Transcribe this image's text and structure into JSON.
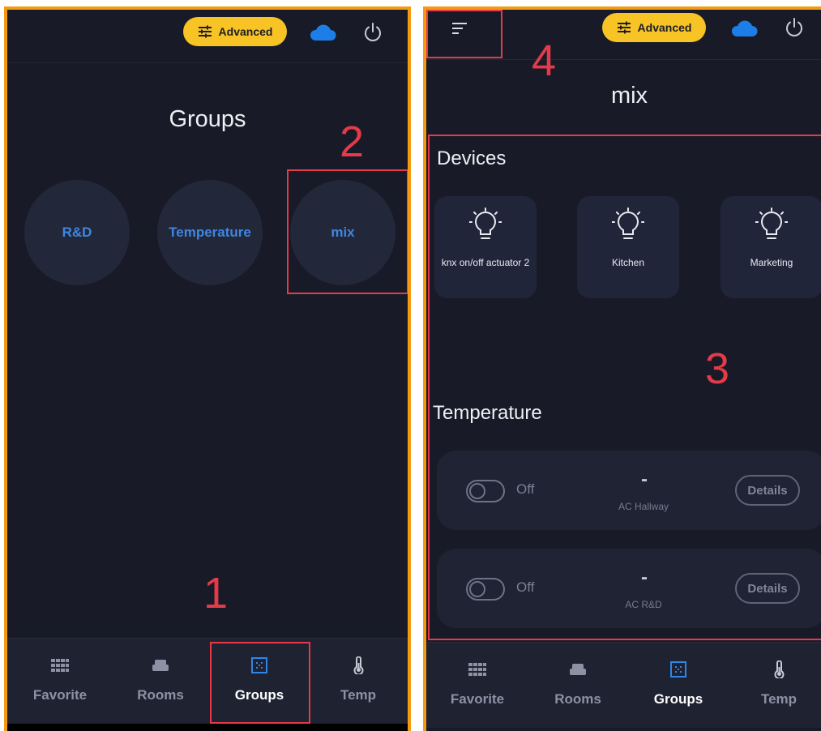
{
  "left_screen": {
    "advanced_label": "Advanced",
    "title": "Groups",
    "groups": [
      {
        "label": "R&D"
      },
      {
        "label": "Temperature"
      },
      {
        "label": "mix"
      }
    ],
    "nav": [
      {
        "label": "Favorite",
        "icon": "grid-icon"
      },
      {
        "label": "Rooms",
        "icon": "sofa-icon"
      },
      {
        "label": "Groups",
        "icon": "groups-icon",
        "active": true
      },
      {
        "label": "Temp",
        "icon": "thermometer-icon"
      }
    ]
  },
  "right_screen": {
    "advanced_label": "Advanced",
    "title": "mix",
    "devices_heading": "Devices",
    "devices": [
      {
        "label": "knx on/off actuator 2",
        "icon": "bulb-icon"
      },
      {
        "label": "Kitchen",
        "icon": "bulb-icon"
      },
      {
        "label": "Marketing",
        "icon": "bulb-icon"
      }
    ],
    "temperature_heading": "Temperature",
    "temperature_items": [
      {
        "state": "Off",
        "value": "-",
        "name": "AC Hallway",
        "details_label": "Details"
      },
      {
        "state": "Off",
        "value": "-",
        "name": "AC R&D",
        "details_label": "Details"
      }
    ],
    "nav": [
      {
        "label": "Favorite",
        "icon": "grid-icon"
      },
      {
        "label": "Rooms",
        "icon": "sofa-icon"
      },
      {
        "label": "Groups",
        "icon": "groups-icon",
        "active": true
      },
      {
        "label": "Temp",
        "icon": "thermometer-icon"
      }
    ]
  },
  "annotations": [
    "1",
    "2",
    "3",
    "4"
  ],
  "colors": {
    "background": "#181b27",
    "frame": "#f39a12",
    "accent_yellow": "#f7c325",
    "accent_blue": "#3d87e4",
    "annotation_red": "#e43a4a"
  }
}
